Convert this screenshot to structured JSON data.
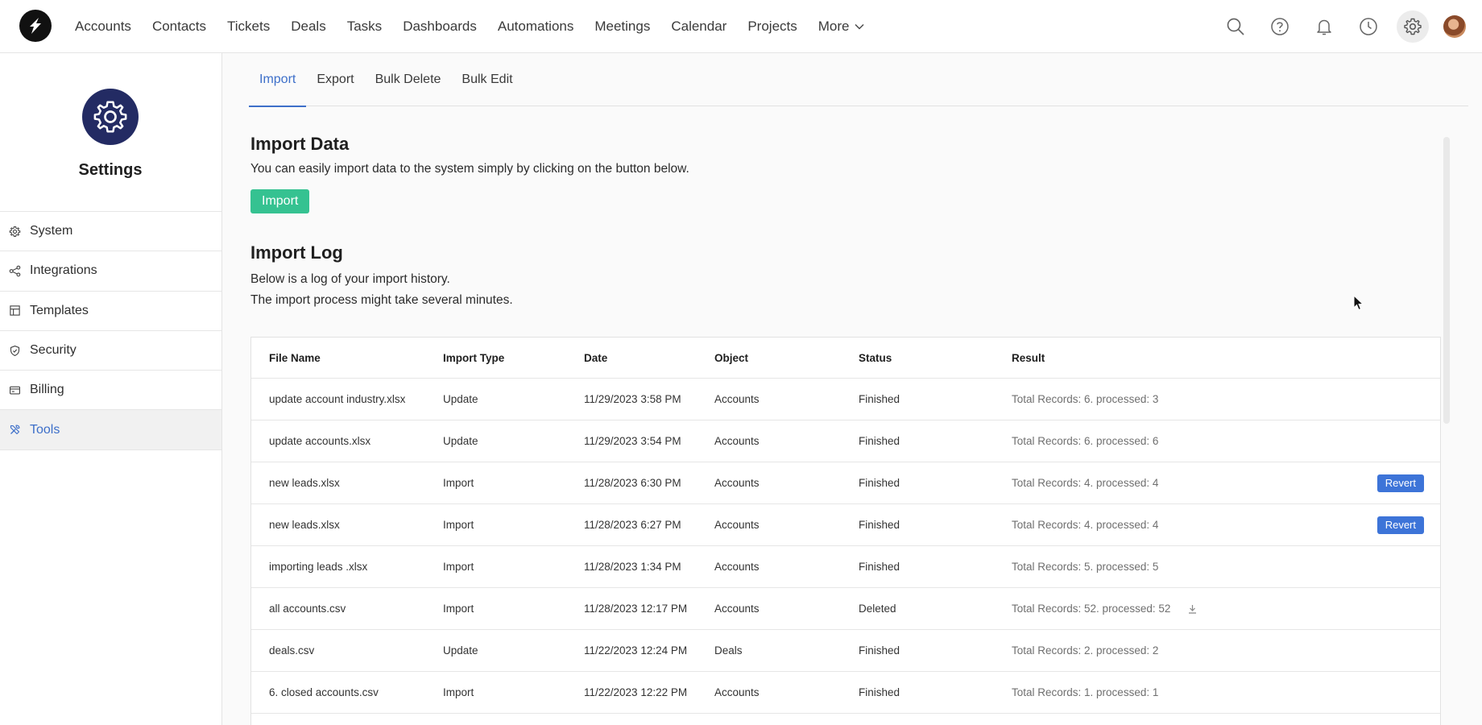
{
  "nav": {
    "items": [
      "Accounts",
      "Contacts",
      "Tickets",
      "Deals",
      "Tasks",
      "Dashboards",
      "Automations",
      "Meetings",
      "Calendar",
      "Projects"
    ],
    "more_label": "More"
  },
  "top_icons": [
    "search-icon",
    "help-icon",
    "bell-icon",
    "clock-icon",
    "gear-icon",
    "avatar"
  ],
  "sidebar": {
    "title": "Settings",
    "items": [
      {
        "label": "System",
        "icon": "gear-icon"
      },
      {
        "label": "Integrations",
        "icon": "share-icon"
      },
      {
        "label": "Templates",
        "icon": "layout-icon"
      },
      {
        "label": "Security",
        "icon": "shield-icon"
      },
      {
        "label": "Billing",
        "icon": "card-icon"
      },
      {
        "label": "Tools",
        "icon": "tools-icon",
        "active": true
      }
    ]
  },
  "tabs": [
    {
      "label": "Import",
      "active": true
    },
    {
      "label": "Export"
    },
    {
      "label": "Bulk Delete"
    },
    {
      "label": "Bulk Edit"
    }
  ],
  "import_data": {
    "title": "Import Data",
    "description": "You can easily import data to the system simply by clicking on the button below.",
    "button": "Import"
  },
  "import_log": {
    "title": "Import Log",
    "line1": "Below is a log of your import history.",
    "line2": "The import process might take several minutes.",
    "columns": [
      "File Name",
      "Import Type",
      "Date",
      "Object",
      "Status",
      "Result"
    ],
    "rows": [
      {
        "file": "update account industry.xlsx",
        "type": "Update",
        "date": "11/29/2023 3:58 PM",
        "object": "Accounts",
        "status": "Finished",
        "result": "Total Records: 6. processed: 3",
        "revert": false,
        "download": false
      },
      {
        "file": "update accounts.xlsx",
        "type": "Update",
        "date": "11/29/2023 3:54 PM",
        "object": "Accounts",
        "status": "Finished",
        "result": "Total Records: 6. processed: 6",
        "revert": false,
        "download": false
      },
      {
        "file": "new leads.xlsx",
        "type": "Import",
        "date": "11/28/2023 6:30 PM",
        "object": "Accounts",
        "status": "Finished",
        "result": "Total Records: 4. processed: 4",
        "revert": true,
        "download": false
      },
      {
        "file": "new leads.xlsx",
        "type": "Import",
        "date": "11/28/2023 6:27 PM",
        "object": "Accounts",
        "status": "Finished",
        "result": "Total Records: 4. processed: 4",
        "revert": true,
        "download": false
      },
      {
        "file": "importing leads .xlsx",
        "type": "Import",
        "date": "11/28/2023 1:34 PM",
        "object": "Accounts",
        "status": "Finished",
        "result": "Total Records: 5. processed: 5",
        "revert": false,
        "download": false
      },
      {
        "file": "all accounts.csv",
        "type": "Import",
        "date": "11/28/2023 12:17 PM",
        "object": "Accounts",
        "status": "Deleted",
        "result": "Total Records: 52. processed: 52",
        "revert": false,
        "download": true
      },
      {
        "file": "deals.csv",
        "type": "Update",
        "date": "11/22/2023 12:24 PM",
        "object": "Deals",
        "status": "Finished",
        "result": "Total Records: 2. processed: 2",
        "revert": false,
        "download": false
      },
      {
        "file": "6. closed accounts.csv",
        "type": "Import",
        "date": "11/22/2023 12:22 PM",
        "object": "Accounts",
        "status": "Finished",
        "result": "Total Records: 1. processed: 1",
        "revert": false,
        "download": false
      }
    ],
    "revert_label": "Revert"
  },
  "colors": {
    "accent": "#3d6fc9",
    "import_button": "#35c291",
    "revert_button": "#3d74d8",
    "settings_badge": "#232b63"
  }
}
